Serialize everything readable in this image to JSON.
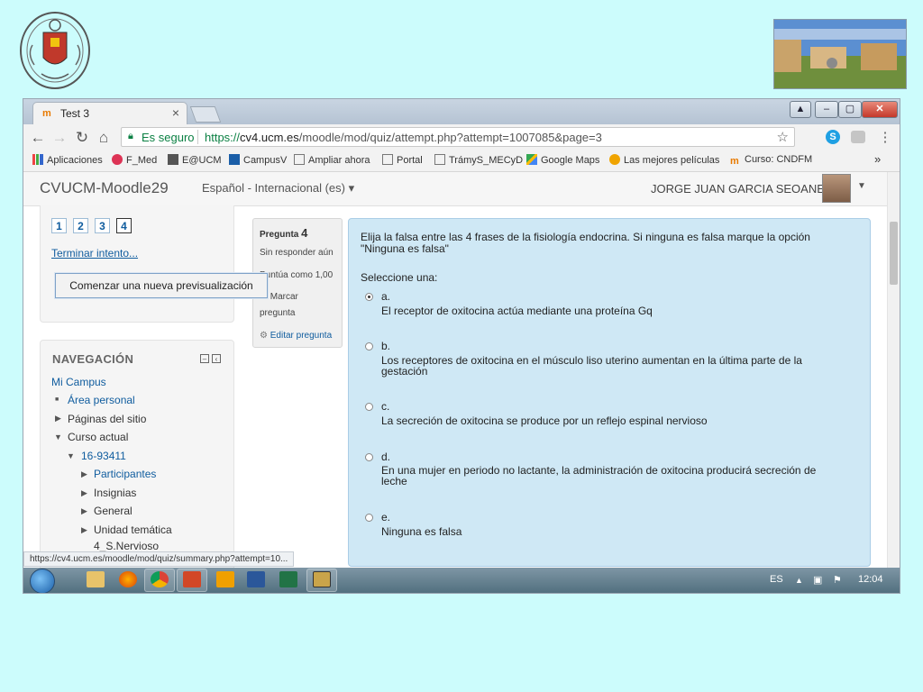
{
  "browser": {
    "tab_title": "Test 3",
    "secure_label": "Es seguro",
    "url_scheme": "https://",
    "url_host": "cv4.ucm.es",
    "url_path": "/moodle/mod/quiz/attempt.php?attempt=1007085&page=3",
    "bookmarks": [
      "Aplicaciones",
      "F_Med",
      "E@UCM",
      "CampusV",
      "Ampliar ahora",
      "Portal",
      "TrámyS_MECyD",
      "Google Maps",
      "Las mejores películas",
      "Curso: CNDFM"
    ],
    "bookmarks_overflow": "»",
    "status_url": "https://cv4.ucm.es/moodle/mod/quiz/summary.php?attempt=10..."
  },
  "moodle": {
    "site_name": "CVUCM-Moodle29",
    "language": "Español - Internacional (es)",
    "user_name": "JORGE JUAN GARCIA SEOANE"
  },
  "quiz_nav": {
    "buttons": [
      "1",
      "2",
      "3",
      "4"
    ],
    "finish_link": "Terminar intento...",
    "new_preview_button": "Comenzar una nueva previsualización"
  },
  "navigation": {
    "title": "NAVEGACIÓN",
    "my_campus": "Mi Campus",
    "personal_area": "Área personal",
    "site_pages": "Páginas del sitio",
    "current_course": "Curso actual",
    "course_code": "16-93411",
    "participants": "Participantes",
    "badges": "Insignias",
    "general": "General",
    "unit_line1": "Unidad temática",
    "unit_line2": "4_S.Nervioso"
  },
  "question_info": {
    "label": "Pregunta",
    "number": "4",
    "state": "Sin responder aún",
    "score": "Puntúa como 1,00",
    "flag_line1": "Marcar",
    "flag_line2": "pregunta",
    "edit_link": "Editar pregunta"
  },
  "question": {
    "text_line1": "Elija la falsa entre las 4 frases de la fisiología endocrina. Si ninguna es falsa marque la opción",
    "text_line2": "\"Ninguna es falsa\"",
    "prompt": "Seleccione una:",
    "options": [
      {
        "letter": "a.",
        "line1": "El receptor de oxitocina actúa mediante una proteína Gq",
        "line2": ""
      },
      {
        "letter": "b.",
        "line1": "Los receptores de oxitocina en el músculo liso uterino aumentan en la última parte de la",
        "line2": "gestación"
      },
      {
        "letter": "c.",
        "line1": "La secreción de oxitocina se produce por un reflejo espinal nervioso",
        "line2": ""
      },
      {
        "letter": "d.",
        "line1": "En una mujer en periodo no lactante, la administración de oxitocina producirá secreción de",
        "line2": "leche"
      },
      {
        "letter": "e.",
        "line1": "Ninguna es falsa",
        "line2": ""
      }
    ],
    "selected_index": 0
  },
  "taskbar": {
    "language": "ES",
    "clock": "12:04"
  }
}
